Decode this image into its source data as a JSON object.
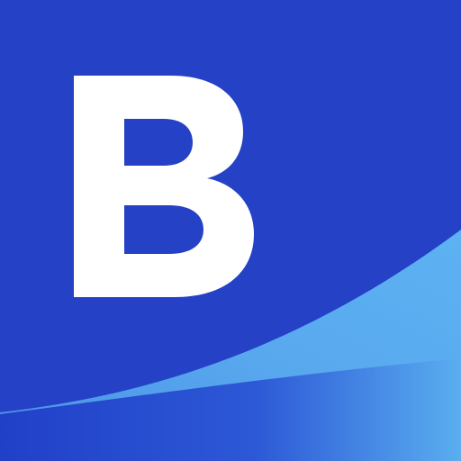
{
  "icon": {
    "letter": "B",
    "colors": {
      "background": "#2541c6",
      "wave_light": "#5aaef0",
      "wave_mid": "#3f7fe0",
      "band_dark": "#2140c8",
      "letter": "#ffffff"
    }
  }
}
